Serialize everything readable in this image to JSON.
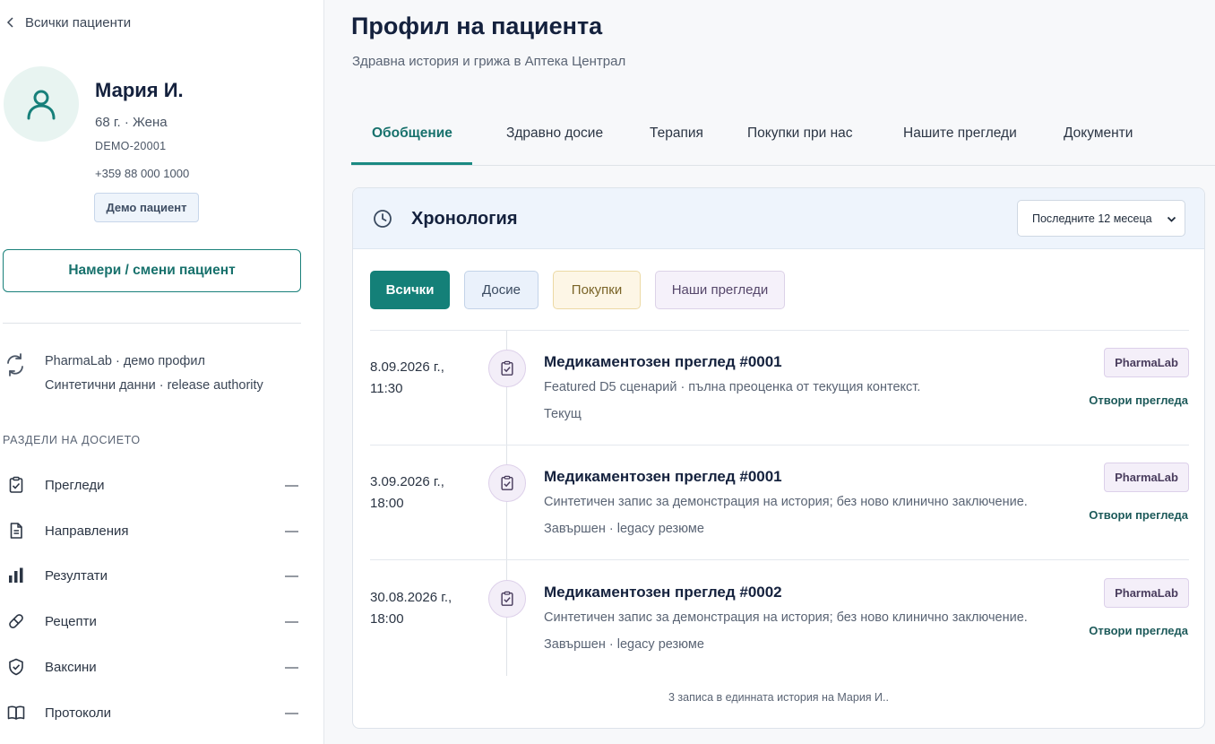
{
  "sidebar": {
    "back_label": "Всички пациенти",
    "patient": {
      "name": "Мария И.",
      "age_gender": "68 г. · Жена",
      "id": "DEMO-20001",
      "phone": "+359 88 000 1000",
      "badge": "Демо пациент"
    },
    "find_button": "Намери / смени пациент",
    "sync": {
      "line1": "PharmaLab · демо профил",
      "line2": "Синтетични данни · release authority"
    },
    "sections_heading": "РАЗДЕЛИ НА ДОСИЕТО",
    "sections": [
      {
        "label": "Прегледи",
        "value": "—",
        "icon": "clipboard-check-icon"
      },
      {
        "label": "Направления",
        "value": "—",
        "icon": "document-icon"
      },
      {
        "label": "Резултати",
        "value": "—",
        "icon": "bar-chart-icon"
      },
      {
        "label": "Рецепти",
        "value": "—",
        "icon": "pill-icon"
      },
      {
        "label": "Ваксини",
        "value": "—",
        "icon": "shield-check-icon"
      },
      {
        "label": "Протоколи",
        "value": "—",
        "icon": "book-icon"
      }
    ]
  },
  "header": {
    "title": "Профил на пациента",
    "subtitle": "Здравна история и грижа в Аптека Централ"
  },
  "tabs": [
    {
      "label": "Обобщение",
      "active": true
    },
    {
      "label": "Здравно досие",
      "active": false
    },
    {
      "label": "Терапия",
      "active": false
    },
    {
      "label": "Покупки при нас",
      "active": false
    },
    {
      "label": "Нашите прегледи",
      "active": false
    },
    {
      "label": "Документи",
      "active": false
    }
  ],
  "timeline": {
    "title": "Хронология",
    "period": "Последните 12 месеца",
    "filters": {
      "all": "Всички",
      "dossier": "Досие",
      "purchases": "Покупки",
      "reviews": "Наши прегледи"
    },
    "entries": [
      {
        "date": "8.09.2026 г.,",
        "time": "11:30",
        "title": "Медикаментозен преглед #0001",
        "description": "Featured D5 сценарий · пълна преоценка от текущия контекст.",
        "status": "Текущ",
        "badge": "PharmaLab",
        "action": "Отвори прегледа"
      },
      {
        "date": "3.09.2026 г.,",
        "time": "18:00",
        "title": "Медикаментозен преглед #0001",
        "description": "Синтетичен запис за демонстрация на история; без ново клинично заключение.",
        "status": "Завършен · legacy резюме",
        "badge": "PharmaLab",
        "action": "Отвори прегледа"
      },
      {
        "date": "30.08.2026 г.,",
        "time": "18:00",
        "title": "Медикаментозен преглед #0002",
        "description": "Синтетичен запис за демонстрация на история; без ново клинично заключение.",
        "status": "Завършен · legacy резюме",
        "badge": "PharmaLab",
        "action": "Отвори прегледа"
      }
    ],
    "footer": "3 записа в единната история на Мария И.."
  },
  "colors": {
    "accent": "#148078",
    "title": "#14213d"
  }
}
